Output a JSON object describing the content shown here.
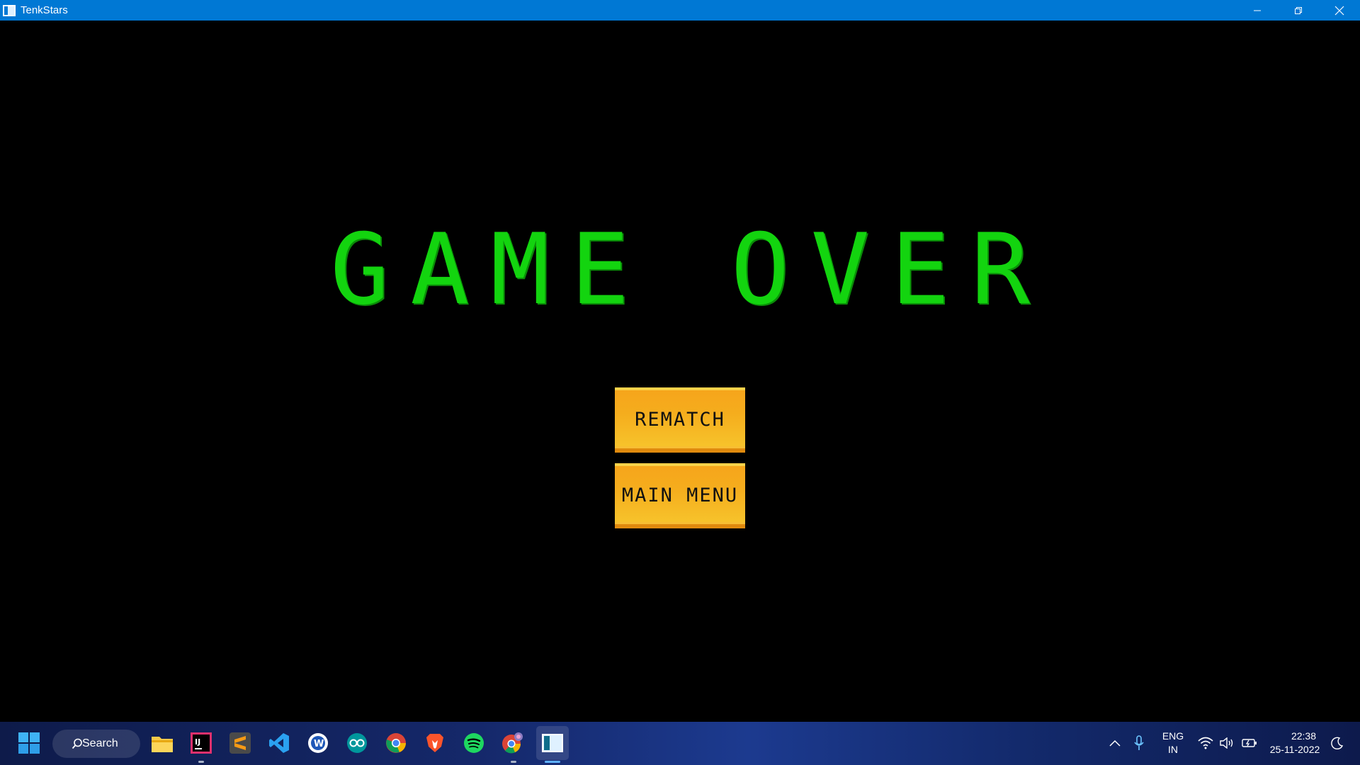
{
  "window": {
    "title": "TenkStars"
  },
  "game": {
    "heading": "GAME OVER",
    "buttons": {
      "rematch": "REMATCH",
      "main_menu": "MAIN MENU"
    },
    "colors": {
      "heading": "#13d40f",
      "button": "#f5ad1d",
      "background": "#000000"
    }
  },
  "taskbar": {
    "search_label": "Search",
    "apps": [
      "windows-start-icon",
      "file-explorer-icon",
      "intellij-icon",
      "sublime-text-icon",
      "vscode-icon",
      "word-app-icon",
      "arduino-icon",
      "chrome-icon",
      "brave-icon",
      "spotify-icon",
      "chrome-profile-icon",
      "tenkstars-app-icon"
    ],
    "tray": {
      "language_top": "ENG",
      "language_bottom": "IN",
      "time": "22:38",
      "date": "25-11-2022"
    }
  }
}
